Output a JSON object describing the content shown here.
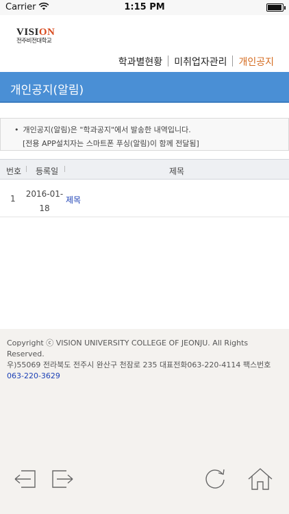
{
  "status_bar": {
    "carrier": "Carrier",
    "time": "1:15 PM",
    "wifi_icon": "wifi-icon",
    "battery_icon": "battery-icon"
  },
  "logo": {
    "vision_prefix": "VISI",
    "vision_accent": "ON",
    "school": "전주비전대학교"
  },
  "nav": {
    "items": [
      "학과별현황",
      "미취업자관리",
      "개인공지"
    ],
    "active": "개인공지",
    "accent_color": "#d46a1e"
  },
  "banner": {
    "title": "개인공지(알림)",
    "color": "#4a8fd5"
  },
  "notice": {
    "bullet": "•",
    "line1": "개인공지(알림)은 \"학과공지\"에서 발송한 내역입니다.",
    "line2": "[전용 APP설치자는 스마트폰 푸싱(알림)이 함께 전달됨]"
  },
  "table": {
    "columns": [
      "번호",
      "등록일",
      "제목"
    ],
    "separator": "|",
    "rows": [
      {
        "no": "1",
        "date": "2016-01-18",
        "date_line1": "2016-01-",
        "date_line2": "18",
        "title": "제목"
      }
    ]
  },
  "footer": {
    "copyright": "Copyright ⓒ VISION UNIVERSITY COLLEGE OF JEONJU. All Rights Reserved.",
    "address": "우)55069 전라북도 전주시 완산구 천잠로 235 대표전화063-220-4114 팩스번호",
    "fax": "063-220-3629",
    "link_color": "#1a3fb5"
  },
  "toolbar": {
    "icons": [
      "back-arrow-icon",
      "forward-arrow-icon",
      "refresh-icon",
      "home-icon"
    ]
  }
}
